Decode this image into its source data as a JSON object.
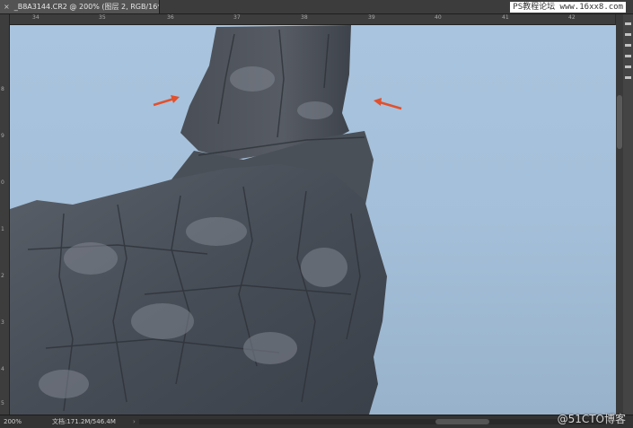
{
  "document_tab": {
    "close_glyph": "×",
    "title": "_B8A3144.CR2 @ 200% (图层 2, RGB/16*) *"
  },
  "watermark_top": "PS教程论坛 www.16xx8.com",
  "ruler_top_labels": [
    "34",
    "35",
    "36",
    "37",
    "38",
    "39",
    "40",
    "41",
    "42"
  ],
  "ruler_left_labels": [
    "8",
    "9",
    "0",
    "1",
    "2",
    "3",
    "4",
    "5"
  ],
  "status_bar": {
    "zoom": "200%",
    "doc_info": "文档:171.2M/546.4M",
    "menu_arrow": "›"
  },
  "watermark_bottom": "@51CTO博客",
  "annotation": {
    "arrow_color": "#e2502c",
    "arrow_count": 2
  },
  "colors": {
    "sky_top": "#a8c3dd",
    "sky_bottom": "#9cb6cf",
    "rock_dark": "#3e444d",
    "rock_light": "#7a808a"
  }
}
